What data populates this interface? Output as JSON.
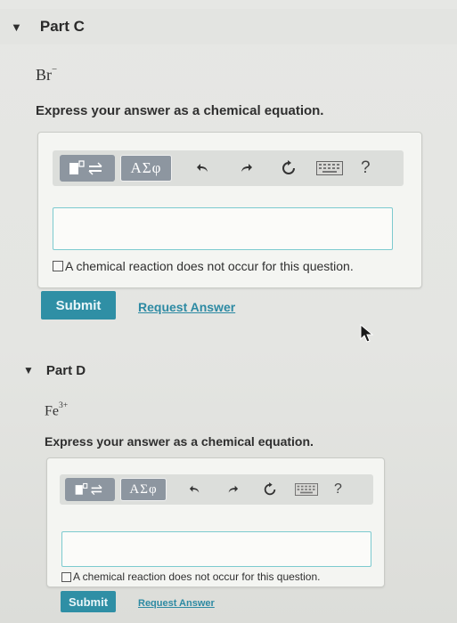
{
  "part_c": {
    "header": "Part C",
    "ion_symbol": "Br",
    "ion_charge": "−",
    "prompt": "Express your answer as a chemical equation.",
    "toolbar": {
      "greek_label": "ΑΣφ",
      "help_label": "?"
    },
    "input_value": "",
    "checkbox_label": "A chemical reaction does not occur for this question.",
    "checkbox_checked": false,
    "submit_label": "Submit",
    "request_label": "Request Answer"
  },
  "part_d": {
    "header": "Part D",
    "ion_symbol": "Fe",
    "ion_charge": "3+",
    "prompt": "Express your answer as a chemical equation.",
    "toolbar": {
      "greek_label": "ΑΣφ",
      "help_label": "?"
    },
    "input_value": "",
    "checkbox_label": "A chemical reaction does not occur for this question.",
    "checkbox_checked": false,
    "submit_label": "Submit",
    "request_label": "Request Answer"
  },
  "icons": {
    "collapse": "caret-down-icon",
    "templates": "templates-icon",
    "undo": "undo-icon",
    "redo": "redo-icon",
    "reset": "reset-icon",
    "keyboard": "keyboard-icon",
    "pointer": "mouse-cursor-icon"
  },
  "colors": {
    "accent": "#2f8fa5",
    "input_border": "#7ccacf",
    "toolbar_button": "#8d96a0"
  }
}
